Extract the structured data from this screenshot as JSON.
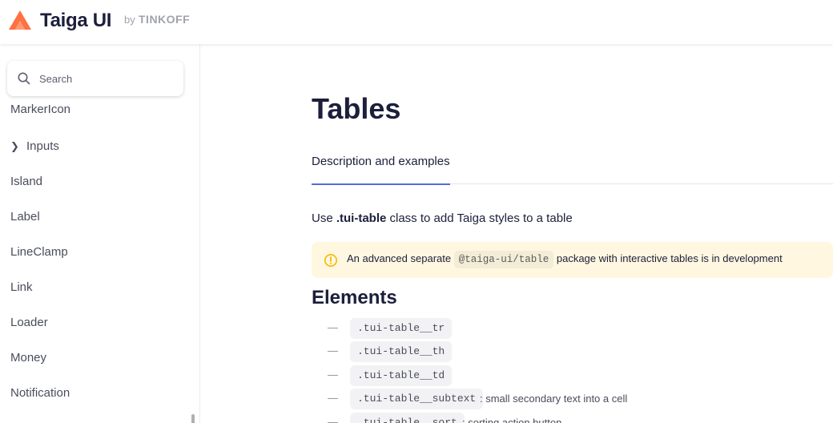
{
  "header": {
    "brand": "Taiga UI",
    "by": "by",
    "byname": "TINKOFF",
    "accent_color": "#ff7043",
    "logo_icon": "taiga-logo-icon"
  },
  "sidebar": {
    "search": {
      "placeholder": "Search",
      "value": ""
    },
    "items": [
      {
        "label": "MarkerIcon",
        "expandable": false
      },
      {
        "label": "Inputs",
        "expandable": true
      },
      {
        "label": "Island",
        "expandable": false
      },
      {
        "label": "Label",
        "expandable": false
      },
      {
        "label": "LineClamp",
        "expandable": false
      },
      {
        "label": "Link",
        "expandable": false
      },
      {
        "label": "Loader",
        "expandable": false
      },
      {
        "label": "Money",
        "expandable": false
      },
      {
        "label": "Notification",
        "expandable": false
      }
    ]
  },
  "main": {
    "title": "Tables",
    "tabs": [
      {
        "label": "Description and examples",
        "active": true
      }
    ],
    "intro": {
      "prefix": "Use ",
      "class_name": ".tui-table",
      "suffix": " class to add Taiga styles to a table"
    },
    "notice": {
      "prefix": "An advanced separate ",
      "code": "@taiga-ui/table",
      "suffix": " package with interactive tables is in development",
      "background": "#fff7e0",
      "icon_color": "#f5b800"
    },
    "elements_heading": "Elements",
    "elements": [
      {
        "dash": "—",
        "code": ".tui-table__tr",
        "desc": ""
      },
      {
        "dash": "—",
        "code": ".tui-table__th",
        "desc": ""
      },
      {
        "dash": "—",
        "code": ".tui-table__td",
        "desc": ""
      },
      {
        "dash": "—",
        "code": ".tui-table__subtext",
        "desc": ": small secondary text into a cell"
      },
      {
        "dash": "—",
        "code": ".tui-table__sort",
        "desc": ": sorting action button"
      }
    ],
    "tab_underline_color": "#526ed3"
  }
}
